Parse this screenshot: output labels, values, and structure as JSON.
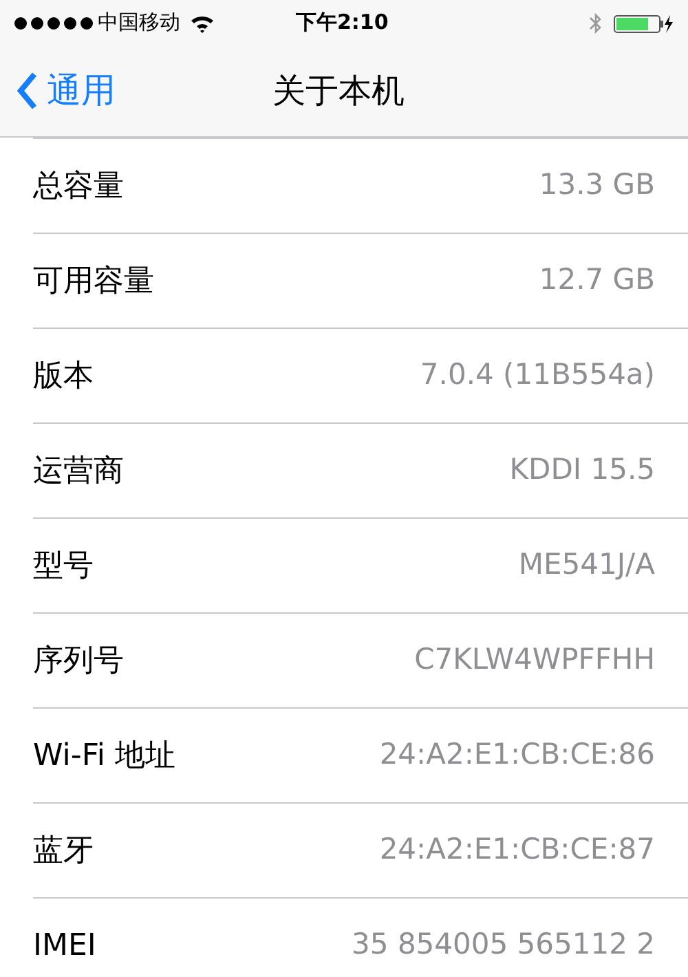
{
  "status_bar": {
    "carrier": "中国移动",
    "time": "下午2:10"
  },
  "nav_bar": {
    "back": "通用",
    "title": "关于本机"
  },
  "rows": [
    {
      "label": "总容量",
      "value": "13.3 GB"
    },
    {
      "label": "可用容量",
      "value": "12.7 GB"
    },
    {
      "label": "版本",
      "value": "7.0.4 (11B554a)"
    },
    {
      "label": "运营商",
      "value": "KDDI 15.5"
    },
    {
      "label": "型号",
      "value": "ME541J/A"
    },
    {
      "label": "序列号",
      "value": "C7KLW4WPFFHH"
    },
    {
      "label": "Wi-Fi 地址",
      "value": "24:A2:E1:CB:CE:86"
    },
    {
      "label": "蓝牙",
      "value": "24:A2:E1:CB:CE:87"
    },
    {
      "label": "IMEI",
      "value": "35 854005 565112 2"
    }
  ]
}
